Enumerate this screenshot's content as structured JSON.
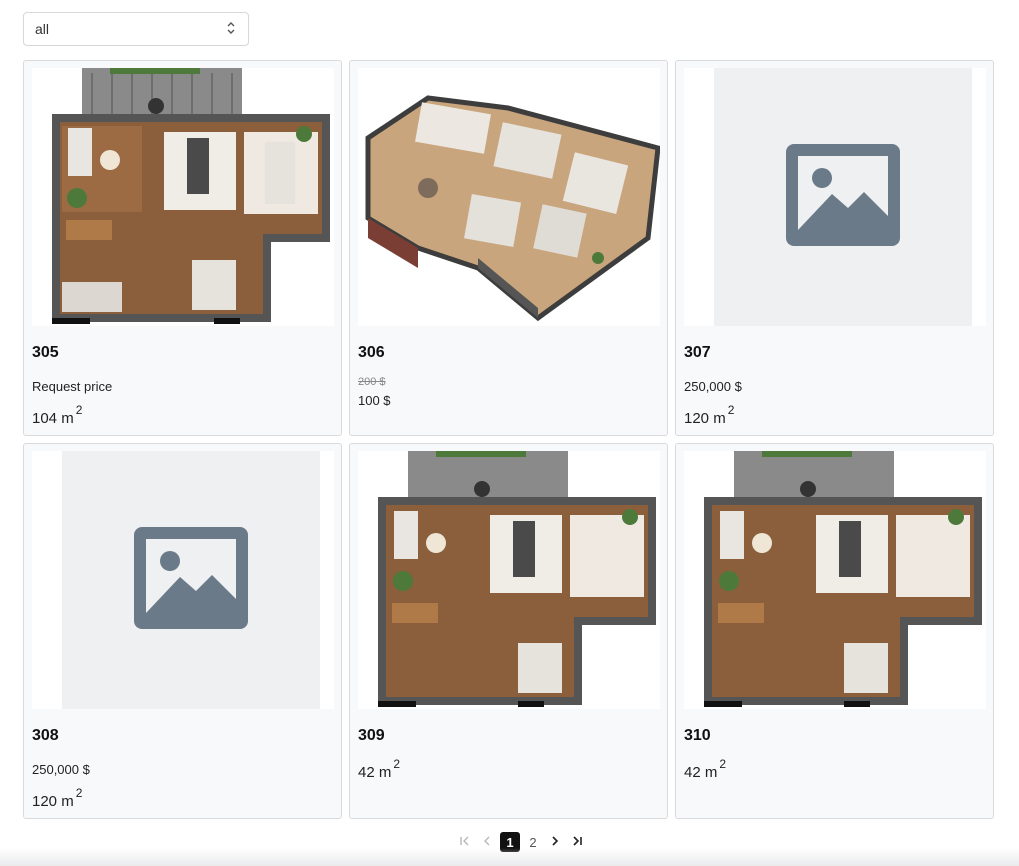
{
  "filter": {
    "value": "all",
    "icon": "chevron-updown-icon"
  },
  "units": [
    {
      "number": "305",
      "image": "floor-plan-top",
      "price": "Request price",
      "area": "104 m",
      "area_unit_sup": "2"
    },
    {
      "number": "306",
      "image": "floor-plan-isometric",
      "old_price": "200 $",
      "new_price": "100 $"
    },
    {
      "number": "307",
      "image": "placeholder-icon",
      "price": "250,000 $",
      "area": "120 m",
      "area_unit_sup": "2"
    },
    {
      "number": "308",
      "image": "placeholder-icon",
      "price": "250,000 $",
      "area": "120 m",
      "area_unit_sup": "2"
    },
    {
      "number": "309",
      "image": "floor-plan-top",
      "area": "42 m",
      "area_unit_sup": "2"
    },
    {
      "number": "310",
      "image": "floor-plan-top",
      "area": "42 m",
      "area_unit_sup": "2"
    }
  ],
  "pagination": {
    "pages": [
      "1",
      "2"
    ],
    "current": "1",
    "icons": [
      "first-page-icon",
      "prev-page-icon",
      "next-page-icon",
      "last-page-icon"
    ]
  },
  "colors": {
    "active_page": "#111111",
    "placeholder_icon": "#6b7a89",
    "card_bg": "#f8f9fa"
  }
}
